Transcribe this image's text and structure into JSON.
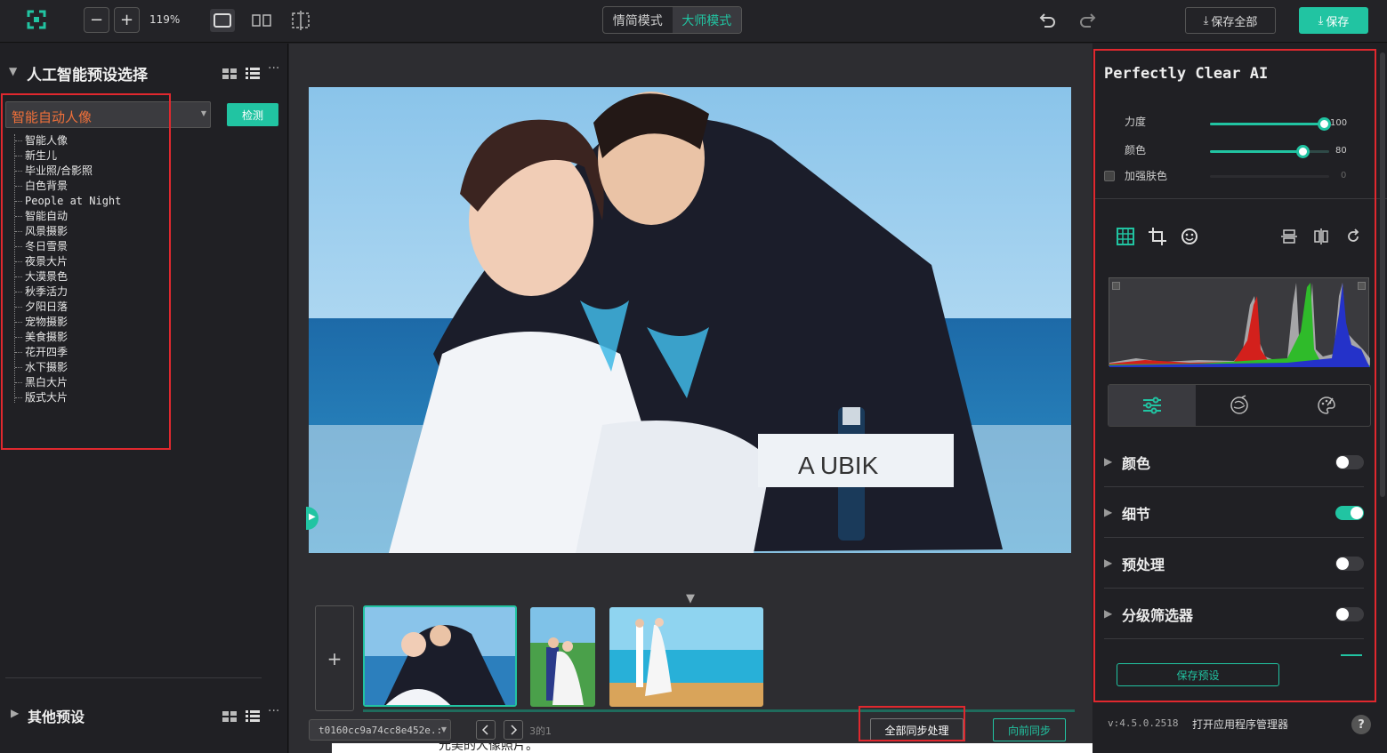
{
  "topbar": {
    "zoom_label": "119%",
    "mode_simple": "情简模式",
    "mode_master": "大师模式",
    "save_all_label": "保存全部",
    "save_label": "保存",
    "accent": "#21c4a2"
  },
  "left": {
    "preset_section_title": "人工智能预设选择",
    "selected_preset": "智能自动人像",
    "detect_label": "检测",
    "presets": [
      "智能人像",
      "新生儿",
      "毕业照/合影照",
      "白色背景",
      "People at Night",
      "智能自动",
      "风景摄影",
      "冬日雪景",
      "夜景大片",
      "大漠景色",
      "秋季活力",
      "夕阳日落",
      "宠物摄影",
      "美食摄影",
      "花开四季",
      "水下摄影",
      "黑白大片",
      "版式大片"
    ],
    "other_presets_title": "其他预设"
  },
  "center": {
    "add_label": "+",
    "file_name": "t0160cc9a74cc8e452e.:",
    "page_info": "3的1",
    "sync_all_label": "全部同步处理",
    "sync_forward_label": "向前同步",
    "bottom_fragment": "元美的人像照片。"
  },
  "right": {
    "panel_title": "Perfectly Clear AI",
    "strength_label": "力度",
    "strength_value": "100",
    "color_label": "颜色",
    "color_value": "80",
    "skin_label": "加强肤色",
    "skin_value": "0",
    "sections": [
      {
        "label": "颜色",
        "on": false
      },
      {
        "label": "细节",
        "on": true
      },
      {
        "label": "预处理",
        "on": false
      },
      {
        "label": "分级筛选器",
        "on": false
      }
    ],
    "save_preset_label": "保存预设",
    "version": "v:4.5.0.2518",
    "open_manager_label": "打开应用程序管理器",
    "help_label": "?"
  }
}
